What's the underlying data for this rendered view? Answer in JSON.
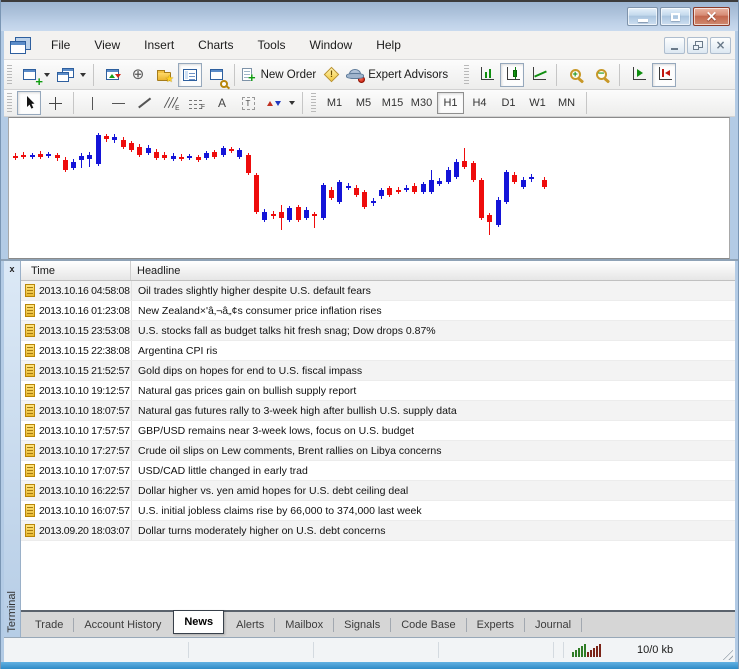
{
  "window": {
    "title": ""
  },
  "menu": {
    "items": [
      "File",
      "View",
      "Insert",
      "Charts",
      "Tools",
      "Window",
      "Help"
    ]
  },
  "toolbar_standard": {
    "new_order_label": "New Order",
    "expert_advisors_label": "Expert Advisors",
    "buttons": [
      "new-chart",
      "profiles",
      "market-watch",
      "data-window",
      "navigator",
      "terminal",
      "strategy-tester",
      "new-order",
      "metaeditor",
      "expert-advisors",
      "bar-chart-mode",
      "candlestick-mode",
      "line-chart-mode",
      "zoom-in",
      "zoom-out",
      "auto-scroll",
      "chart-shift"
    ],
    "pressed": [
      "terminal",
      "candlestick-mode",
      "chart-shift"
    ]
  },
  "toolbar_line_studies": {
    "buttons": [
      "cursor",
      "crosshair",
      "vertical-line",
      "horizontal-line",
      "trend-line",
      "equidistant-channel",
      "fibonacci-retracement",
      "text",
      "text-label",
      "arrows"
    ],
    "pressed": [
      "cursor"
    ]
  },
  "timeframes": {
    "items": [
      "M1",
      "M5",
      "M15",
      "M30",
      "H1",
      "H4",
      "D1",
      "W1",
      "MN"
    ],
    "active": "H1"
  },
  "chart": {
    "type": "candlestick",
    "background": "#ffffff",
    "up_color": "#1414d8",
    "down_color": "#ee0c0c",
    "units": "px",
    "format": [
      "x",
      "wick_top",
      "wick_bottom",
      "body_top",
      "body_bottom",
      "direction u=up(blue) d=down(red)"
    ],
    "candles": [
      [
        4,
        35,
        42,
        38,
        40,
        "d"
      ],
      [
        12,
        34,
        41,
        37,
        39,
        "d"
      ],
      [
        21,
        35,
        41,
        37,
        39,
        "u"
      ],
      [
        29,
        33,
        41,
        36,
        39,
        "d"
      ],
      [
        37,
        34,
        40,
        36,
        38,
        "u"
      ],
      [
        46,
        35,
        43,
        37,
        40,
        "d"
      ],
      [
        54,
        39,
        54,
        42,
        52,
        "d"
      ],
      [
        62,
        41,
        52,
        44,
        50,
        "u"
      ],
      [
        70,
        35,
        50,
        38,
        42,
        "u"
      ],
      [
        78,
        34,
        49,
        37,
        41,
        "u"
      ],
      [
        87,
        15,
        48,
        17,
        46,
        "u"
      ],
      [
        95,
        16,
        24,
        18,
        21,
        "d"
      ],
      [
        103,
        16,
        25,
        19,
        22,
        "u"
      ],
      [
        112,
        19,
        31,
        22,
        29,
        "d"
      ],
      [
        120,
        23,
        34,
        25,
        32,
        "d"
      ],
      [
        128,
        26,
        39,
        29,
        37,
        "d"
      ],
      [
        137,
        27,
        37,
        30,
        35,
        "u"
      ],
      [
        145,
        31,
        42,
        34,
        40,
        "d"
      ],
      [
        153,
        34,
        42,
        37,
        40,
        "d"
      ],
      [
        162,
        35,
        43,
        38,
        41,
        "u"
      ],
      [
        170,
        36,
        43,
        39,
        41,
        "d"
      ],
      [
        178,
        36,
        42,
        38,
        40,
        "u"
      ],
      [
        187,
        37,
        44,
        39,
        42,
        "d"
      ],
      [
        195,
        33,
        42,
        35,
        40,
        "u"
      ],
      [
        203,
        32,
        41,
        34,
        39,
        "d"
      ],
      [
        212,
        28,
        39,
        30,
        37,
        "u"
      ],
      [
        220,
        29,
        35,
        31,
        33,
        "d"
      ],
      [
        228,
        30,
        41,
        32,
        39,
        "u"
      ],
      [
        237,
        35,
        57,
        37,
        55,
        "d"
      ],
      [
        245,
        55,
        96,
        57,
        94,
        "d"
      ],
      [
        253,
        91,
        104,
        94,
        102,
        "u"
      ],
      [
        262,
        93,
        101,
        96,
        98,
        "d"
      ],
      [
        270,
        87,
        112,
        94,
        100,
        "d"
      ],
      [
        278,
        88,
        104,
        90,
        102,
        "u"
      ],
      [
        287,
        87,
        104,
        89,
        102,
        "d"
      ],
      [
        295,
        89,
        102,
        92,
        100,
        "u"
      ],
      [
        303,
        94,
        110,
        96,
        98,
        "d"
      ],
      [
        312,
        65,
        102,
        67,
        100,
        "u"
      ],
      [
        320,
        69,
        82,
        72,
        80,
        "d"
      ],
      [
        328,
        62,
        86,
        64,
        84,
        "u"
      ],
      [
        337,
        65,
        72,
        68,
        70,
        "u"
      ],
      [
        345,
        67,
        79,
        70,
        77,
        "d"
      ],
      [
        353,
        72,
        91,
        74,
        89,
        "d"
      ],
      [
        362,
        80,
        88,
        83,
        85,
        "u"
      ],
      [
        370,
        70,
        81,
        72,
        78,
        "u"
      ],
      [
        378,
        68,
        79,
        70,
        77,
        "d"
      ],
      [
        387,
        69,
        76,
        72,
        74,
        "d"
      ],
      [
        395,
        67,
        74,
        70,
        72,
        "u"
      ],
      [
        403,
        65,
        76,
        68,
        74,
        "d"
      ],
      [
        412,
        64,
        76,
        66,
        74,
        "u"
      ],
      [
        420,
        52,
        76,
        62,
        74,
        "u"
      ],
      [
        428,
        60,
        68,
        63,
        66,
        "u"
      ],
      [
        437,
        49,
        66,
        52,
        64,
        "u"
      ],
      [
        445,
        41,
        61,
        44,
        59,
        "u"
      ],
      [
        453,
        30,
        51,
        43,
        49,
        "d"
      ],
      [
        462,
        43,
        64,
        45,
        62,
        "d"
      ],
      [
        470,
        60,
        102,
        62,
        100,
        "d"
      ],
      [
        478,
        95,
        117,
        97,
        104,
        "d"
      ],
      [
        487,
        79,
        109,
        82,
        107,
        "u"
      ],
      [
        495,
        52,
        86,
        54,
        84,
        "u"
      ],
      [
        503,
        54,
        66,
        57,
        64,
        "d"
      ],
      [
        512,
        59,
        71,
        62,
        69,
        "u"
      ],
      [
        520,
        56,
        64,
        59,
        61,
        "u"
      ],
      [
        533,
        59,
        71,
        62,
        69,
        "d"
      ]
    ]
  },
  "terminal": {
    "label": "Terminal",
    "close_button": "x",
    "news": {
      "columns": [
        "Time",
        "Headline"
      ],
      "rows": [
        {
          "time": "2013.10.16 04:58:08",
          "headline": "Oil trades slightly higher despite U.S. default fears"
        },
        {
          "time": "2013.10.16 01:23:08",
          "headline": "New Zealand×'â‚¬â„¢s consumer price inflation rises"
        },
        {
          "time": "2013.10.15 23:53:08",
          "headline": "U.S. stocks fall as budget talks hit fresh snag; Dow drops 0.87%"
        },
        {
          "time": "2013.10.15 22:38:08",
          "headline": "Argentina CPI ris"
        },
        {
          "time": "2013.10.15 21:52:57",
          "headline": "Gold dips on hopes for end to U.S. fiscal impass"
        },
        {
          "time": "2013.10.10 19:12:57",
          "headline": "Natural gas prices gain on bullish supply report"
        },
        {
          "time": "2013.10.10 18:07:57",
          "headline": "Natural gas futures rally to 3-week high after bullish U.S. supply data"
        },
        {
          "time": "2013.10.10 17:57:57",
          "headline": "GBP/USD remains near 3-week lows, focus on U.S. budget"
        },
        {
          "time": "2013.10.10 17:27:57",
          "headline": "Crude oil slips on Lew comments, Brent rallies on Libya concerns"
        },
        {
          "time": "2013.10.10 17:07:57",
          "headline": "USD/CAD little changed in early trad"
        },
        {
          "time": "2013.10.10 16:22:57",
          "headline": "Dollar higher vs. yen amid hopes for U.S. debt ceiling deal"
        },
        {
          "time": "2013.10.10 16:07:57",
          "headline": "U.S. initial jobless claims rise by 66,000 to 374,000 last week"
        },
        {
          "time": "2013.09.20 18:03:07",
          "headline": "Dollar turns moderately higher on U.S. debt concerns"
        }
      ]
    },
    "tabs": [
      "Trade",
      "Account History",
      "News",
      "Alerts",
      "Mailbox",
      "Signals",
      "Code Base",
      "Experts",
      "Journal"
    ],
    "active_tab": "News"
  },
  "status": {
    "traffic": "10/0 kb"
  }
}
